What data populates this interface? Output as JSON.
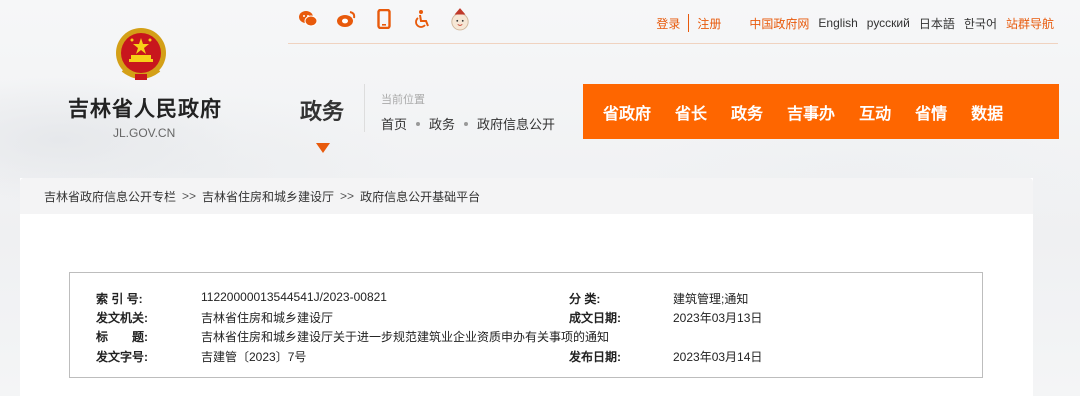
{
  "colors": {
    "accent": "#fe6600",
    "link": "#e85a0c",
    "border": "#bdbdbd"
  },
  "share_icons": [
    "wechat-icon",
    "weibo-icon",
    "mobile-icon",
    "accessibility-icon",
    "mascot-icon"
  ],
  "toplinks": {
    "login": "登录",
    "register": "注册",
    "china_gov": "中国政府网",
    "english": "English",
    "russian": "русский",
    "japanese": "日本語",
    "korean": "한국어",
    "site_group": "站群导航"
  },
  "site": {
    "name": "吉林省人民政府",
    "domain": "JL.GOV.CN"
  },
  "section": {
    "title": "政务",
    "location_label": "当前位置",
    "trail": [
      "首页",
      "政务",
      "政府信息公开"
    ]
  },
  "mainnav": [
    "省政府",
    "省长",
    "政务",
    "吉事办",
    "互动",
    "省情",
    "数据"
  ],
  "breadcrumb": [
    "吉林省政府信息公开专栏",
    "吉林省住房和城乡建设厅",
    "政府信息公开基础平台"
  ],
  "breadcrumb_sep": ">>",
  "info": {
    "index_label": "索 引 号:",
    "index_value": "11220000013544541J/2023-00821",
    "category_label": "分 类:",
    "category_value": "建筑管理;通知",
    "issuer_label": "发文机关:",
    "issuer_value": "吉林省住房和城乡建设厅",
    "created_label": "成文日期:",
    "created_value": "2023年03月13日",
    "title_label": "标　　题:",
    "title_value": "吉林省住房和城乡建设厅关于进一步规范建筑业企业资质申办有关事项的通知",
    "docno_label": "发文字号:",
    "docno_value": "吉建管〔2023〕7号",
    "published_label": "发布日期:",
    "published_value": "2023年03月14日"
  }
}
